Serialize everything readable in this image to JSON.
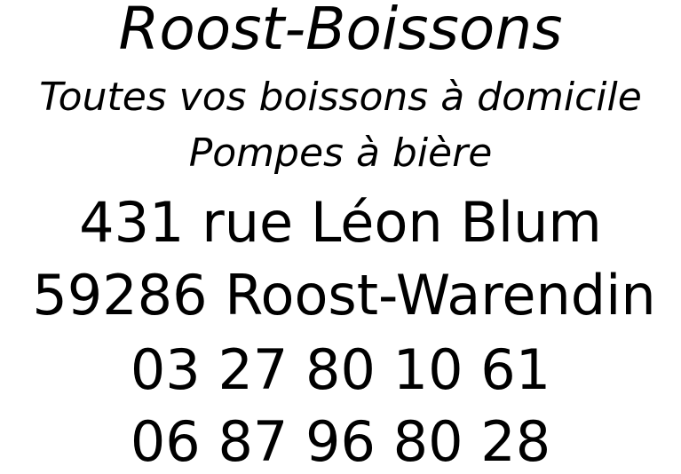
{
  "business": {
    "name": "Roost-Boissons",
    "tagline": "Toutes vos boissons à domicile",
    "service": "Pompes à bière"
  },
  "address": {
    "street": "431 rue Léon Blum",
    "city": "59286 Roost-Warendin"
  },
  "phones": {
    "landline": "03 27 80 10 61",
    "mobile": "06 87 96 80 28"
  },
  "colors": {
    "text": "#000000",
    "background": "#ffffff"
  }
}
